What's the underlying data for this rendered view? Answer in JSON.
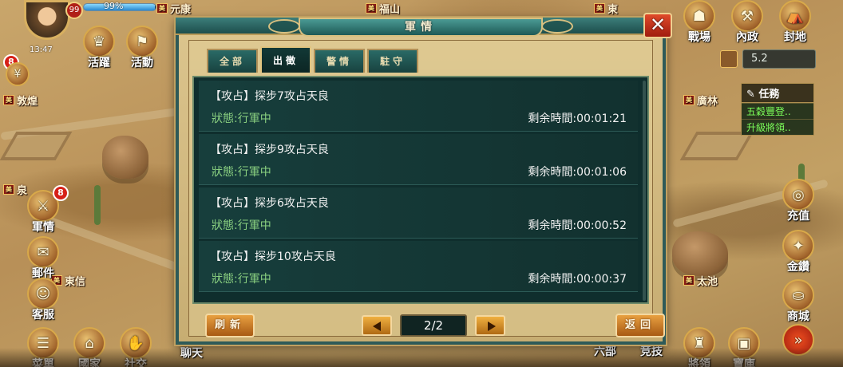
{
  "player": {
    "level": "99",
    "hp_percent": "99%",
    "hp_fill": 0.99,
    "name_partial": "元康",
    "timer": "13:47"
  },
  "map": {
    "cities": [
      "福山",
      "東",
      "敦煌",
      "廣林",
      "泉",
      "東信",
      "太池"
    ]
  },
  "hud_left": {
    "huoyue": "活躍",
    "huodong": "活動",
    "junqing": "軍情",
    "junqing_badge": "8",
    "mail": "郵件",
    "service": "客服",
    "menu": "菜單",
    "country": "國家",
    "social": "社交",
    "chat": "聊天",
    "left_badge": "8"
  },
  "hud_right": {
    "battlefield": "戰場",
    "internal": "內政",
    "fief": "封地",
    "power_value": "5.2",
    "recharge": "充值",
    "gold": "金鑽",
    "shop": "商城",
    "liubu": "六部",
    "arena": "竞技",
    "general": "將領",
    "treasure": "寶庫"
  },
  "tasks": {
    "header": "任務",
    "items": [
      "五穀豐登..",
      "升級將領.."
    ]
  },
  "dialog": {
    "title": "軍情",
    "close": "✕",
    "tabs": [
      "全部",
      "出徵",
      "警情",
      "駐守"
    ],
    "active_tab": 1,
    "rows": [
      {
        "title": "【攻占】探步7攻占天良",
        "status": "狀態:行軍中",
        "time": "剩余時間:00:01:21"
      },
      {
        "title": "【攻占】探步9攻占天良",
        "status": "狀態:行軍中",
        "time": "剩余時間:00:01:06"
      },
      {
        "title": "【攻占】探步6攻占天良",
        "status": "狀態:行軍中",
        "time": "剩余時間:00:00:52"
      },
      {
        "title": "【攻占】探步10攻占天良",
        "status": "狀態:行軍中",
        "time": "剩余時間:00:00:37"
      }
    ],
    "refresh": "刷新",
    "back": "返回",
    "page": "2/2"
  },
  "colors": {
    "dialog_frame": "#2e5a58",
    "list_bg": "#0f2e2d",
    "status_green": "#8ad080",
    "button_orange": "#e8a040"
  }
}
